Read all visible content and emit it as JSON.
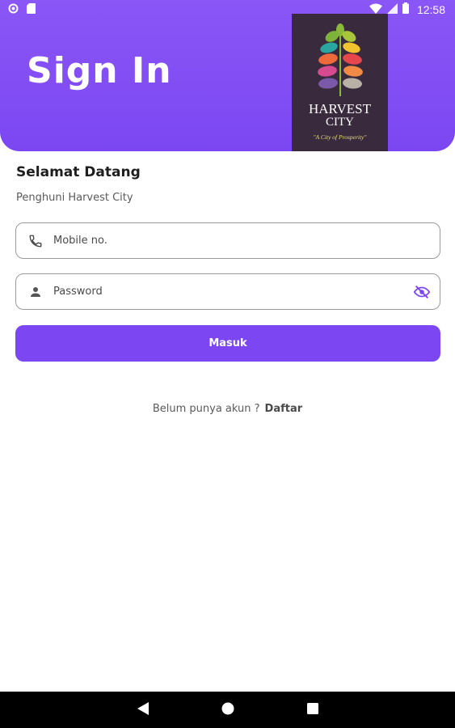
{
  "status_bar": {
    "time": "12:58"
  },
  "header": {
    "title": "Sign In",
    "logo": {
      "line1": "HARVEST",
      "line2": "CITY",
      "tagline": "\"A City of Prosperity\""
    }
  },
  "welcome": {
    "heading": "Selamat Datang",
    "subheading": "Penghuni Harvest City"
  },
  "form": {
    "mobile_placeholder": "Mobile no.",
    "password_placeholder": "Password",
    "submit_label": "Masuk"
  },
  "register": {
    "prompt": "Belum punya akun ?",
    "link": "Daftar"
  },
  "colors": {
    "primary": "#7c47f2",
    "logo_bg": "#3a2a3d",
    "tagline": "#e8df79"
  },
  "icons": [
    "circle-status-icon",
    "sdcard-icon",
    "wifi-icon",
    "signal-icon",
    "battery-icon",
    "phone-icon",
    "person-icon",
    "visibility-off-icon",
    "back-icon",
    "home-icon",
    "recents-icon"
  ]
}
